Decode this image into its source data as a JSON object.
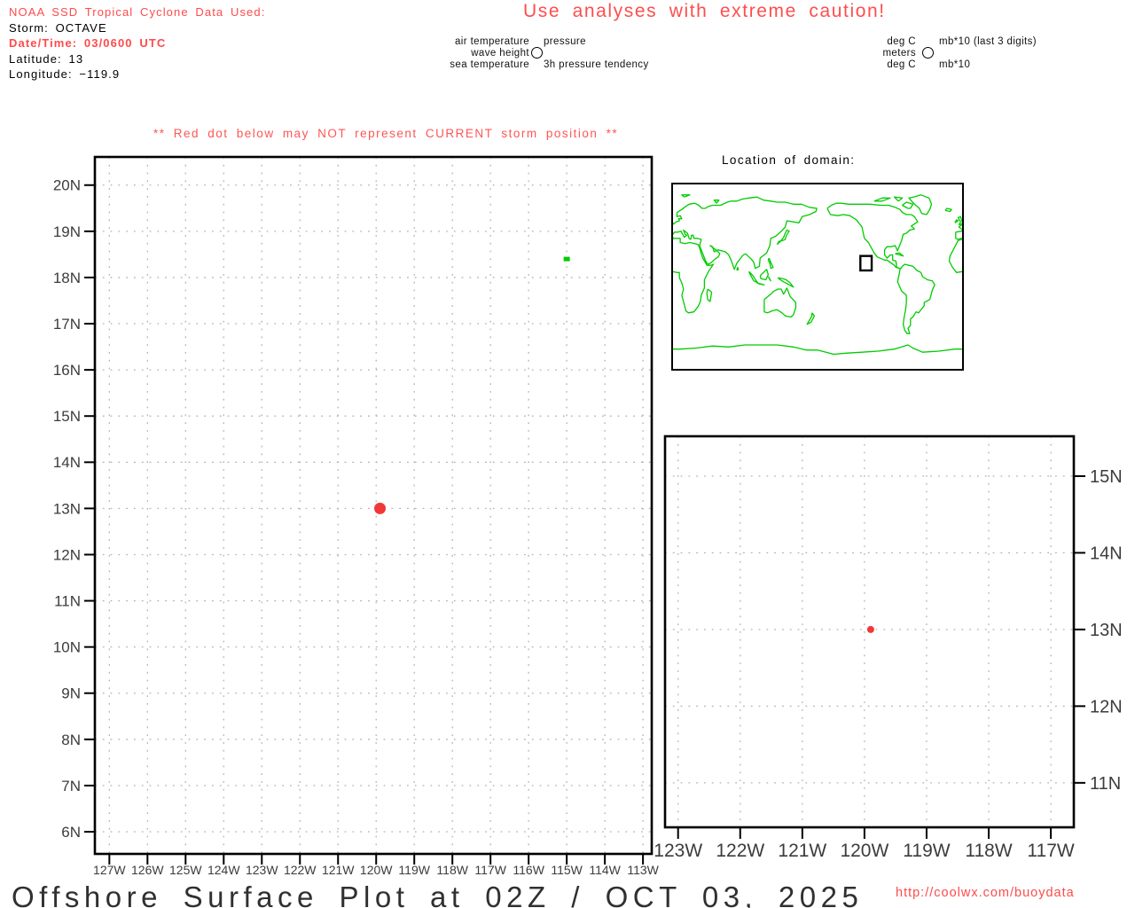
{
  "header": {
    "source_line": "NOAA SSD Tropical Cyclone Data Used:",
    "storm_line": "Storm: OCTAVE",
    "datetime_line": "Date/Time: 03/0600 UTC",
    "latitude_line": "Latitude: 13",
    "longitude_line": "Longitude: −119.9"
  },
  "caution_title": "Use analyses with extreme caution!",
  "legend": {
    "params": {
      "upper_left": "air temperature",
      "middle_left": "wave height",
      "lower_left": "sea temperature",
      "upper_right": "pressure",
      "lower_right": "3h pressure tendency"
    },
    "units": {
      "upper_left": "deg C",
      "middle_left": "meters",
      "lower_left": "deg C",
      "upper_right": "mb*10 (last 3 digits)",
      "lower_right": "mb*10"
    }
  },
  "storm_warning": "** Red dot below may NOT represent CURRENT storm position **",
  "map_inset": {
    "title": "Location of domain:",
    "domain": {
      "lon": [
        -127,
        -113
      ],
      "lat": [
        6,
        20
      ]
    }
  },
  "footer": {
    "title": "Offshore Surface Plot at 02Z / OCT 03, 2025",
    "url": "http://coolwx.com/buoydata"
  },
  "colors": {
    "accent_red": "#ff4a4a",
    "storm_dot": "#f23737",
    "coastline_green": "#00cc00",
    "axis_label": "#3c3c3c",
    "grid": "#b4b4b4"
  },
  "chart_data": [
    {
      "type": "scatter",
      "title": "Offshore surface plot domain (127W-113W, 6N-20N)",
      "grid": "dotted",
      "x_axis": {
        "ticks": [
          "127W",
          "126W",
          "125W",
          "124W",
          "123W",
          "122W",
          "121W",
          "120W",
          "119W",
          "118W",
          "117W",
          "116W",
          "115W",
          "114W",
          "113W"
        ],
        "values": [
          -127,
          -126,
          -125,
          -124,
          -123,
          -122,
          -121,
          -120,
          -119,
          -118,
          -117,
          -116,
          -115,
          -114,
          -113
        ],
        "lim": [
          -127.38,
          -112.77
        ]
      },
      "y_axis": {
        "ticks": [
          "20N",
          "19N",
          "18N",
          "17N",
          "16N",
          "15N",
          "14N",
          "13N",
          "12N",
          "11N",
          "10N",
          "9N",
          "8N",
          "7N",
          "6N"
        ],
        "values": [
          20,
          19,
          18,
          17,
          16,
          15,
          14,
          13,
          12,
          11,
          10,
          9,
          8,
          7,
          6
        ],
        "lim": [
          5.52,
          20.61
        ]
      },
      "points": [
        {
          "name": "storm-position-dot",
          "lon": -119.9,
          "lat": 13.0,
          "shape": "circle",
          "r": 6.5,
          "color": "#f23737"
        },
        {
          "name": "observation-marker",
          "lon": -115.0,
          "lat": 18.4,
          "shape": "dash",
          "r": 3.5,
          "color": "#00cc00"
        }
      ]
    },
    {
      "type": "scatter",
      "title": "Zoomed domain near storm (123W-117W, 11N-15N)",
      "grid": "dotted",
      "x_axis": {
        "ticks": [
          "123W",
          "122W",
          "121W",
          "120W",
          "119W",
          "118W",
          "117W"
        ],
        "values": [
          -123,
          -122,
          -121,
          -120,
          -119,
          -118,
          -117
        ],
        "lim": [
          -123.21,
          -116.63
        ]
      },
      "y_axis": {
        "ticks": [
          "15N",
          "14N",
          "13N",
          "12N",
          "11N"
        ],
        "values": [
          15,
          14,
          13,
          12,
          11
        ],
        "lim": [
          10.42,
          15.52
        ]
      },
      "points": [
        {
          "name": "storm-position-dot",
          "lon": -119.9,
          "lat": 13.0,
          "shape": "circle",
          "r": 4,
          "color": "#f23737"
        }
      ]
    }
  ],
  "world_map": {
    "coastlines": [
      "-9,43 -2,44 0,45 -5,48 -2,50 2,51 5,53 9,54 8,56 12,56 10,59 6,58 6,62 12,65 17,68 21,70 28,71 33,69 37,66 41,66 45,68 50,69 60,69 68,72 73,73 80,73 87,75 95,76 105,77 113,74 122,73 130,72 140,72 150,70 160,70 170,67 179,66 178,63 170,60 161,58 157,52 142,54 140,48 134,43 128,39 122,37 121,30 117,23 109,18 108,10 103,8 101,14 98,17 91,22 88,21 85,18 80,13 77,7 73,16 70,21 66,24 61,25 57,26 52,24 50,29 47,30 54,26 57,24 59,22 57,19 53,17 49,14 45,12 43,13 41,16 38,22 35,28 34,30 35,33 36,36 31,37 27,37 26,40 24,40 23,36 21,37 19,42 14,45 16,41 18,40 15,38 11,44 7,43 3,43 0,40 1,38 -2,37 -6,36 -9,37 -9,43",
      "-6,35 3,37 10,37 10,33 16,32 22,33 28,32 32,31 34,28 36,22 38,18 43,11 48,11 51,12 45,5 40,-3 40,-11 36,-18 35,-24 32,-29 27,-34 20,-35 17,-33 15,-27 12,-18 14,-12 12,-6 9,-1 9,4 6,4 0,5 -8,4 -13,9 -17,15 -16,20 -10,29 -6,35",
      "-168,66 -164,60 -155,59 -148,60 -140,59 -132,55 -125,48 -122,37 -117,33 -110,23 -106,19 -97,16 -94,16 -85,11 -83,9 -78,8 -82,9 -83,15 -87,16 -87,21 -90,21 -94,18 -97,21 -97,26 -94,29 -89,29 -84,30 -81,25 -80,27 -76,35 -74,41 -70,42 -66,45 -60,46 -64,49 -58,52 -56,53 -60,58 -64,60 -70,60 -75,62 -78,65 -84,67 -92,69 -102,69 -115,70 -128,70 -141,70 -151,71 -157,71 -163,69 -168,66",
      "-45,60 -41,65 -39,70 -42,76 -52,79 -61,77 -67,76 -60,70 -54,66 -51,61 -45,60",
      "-78,7 -79,2 -81,-5 -76,-14 -70,-18 -70,-25 -71,-32 -73,-40 -74,-46 -72,-52 -69,-55 -66,-55 -68,-50 -65,-47 -65,-41 -62,-39 -58,-34 -55,-35 -53,-33 -48,-28 -48,-25 -41,-22 -38,-13 -35,-8 -38,-4 -44,-3 -50,0 -52,4 -57,6 -62,10 -67,11 -72,12 -75,10 -78,7",
      "-180,-71 -160,-75 -145,-74 -125,-73 -105,-72 -85,-70 -68,-66 -62,-69 -50,-73 -30,-72 -10,-70 10,-70 30,-69 50,-67 70,-68 90,-66 110,-66 130,-66 150,-68 166,-71 180,-71",
      "114,-22 114,-34 118,-35 124,-33 130,-32 136,-35 140,-38 147,-39 150,-37 153,-30 153,-25 146,-19 142,-11 138,-17 135,-12 131,-12 126,-14 122,-17 114,-22",
      "130,31 132,34 137,35 140,36 141,39 143,42 145,44 142,45 140,42 138,38 134,34 131,32 130,31",
      "-5,50 -3,53 -6,57 -3,58 -1,53 1,52 -5,50",
      "-10,52 -6,54 -8,55 -10,52",
      "-22,64 -16,63 -14,65 -20,66 -22,64",
      "95,5 100,1 104,-4 106,-6 101,-4 96,3 95,5",
      "109,1 113,4 117,7 119,2 116,-3 110,-2 109,1",
      "105,-6 110,-7 114,-8 108,-7 105,-6",
      "131,-1 137,-2 141,-3 146,-6 150,-10 145,-8 138,-5 132,-2 131,-1",
      "120,18 122,14 125,9 122,8 121,13 119,16 120,18",
      "119,0 122,-4 120,-1 119,0",
      "173,-35 176,-38 174,-41 172,-44 167,-46 170,-42 173,-38 173,-35",
      "44,-12 49,-15 47,-24 44,-22 43,-16 44,-12",
      "-84,22 -78,21 -74,20 -79,23 -84,22",
      "80,6 82,7 81,9 80,6",
      "-65,66 -62,70 -70,72 -75,69 -68,66 -65,66",
      "-110,73 -100,76 -90,76 -100,73 -110,73",
      "-80,73 -75,76 -85,77 -80,73",
      "55,71 58,74 52,74 55,71",
      "15,77 22,79 12,79 15,77"
    ]
  }
}
